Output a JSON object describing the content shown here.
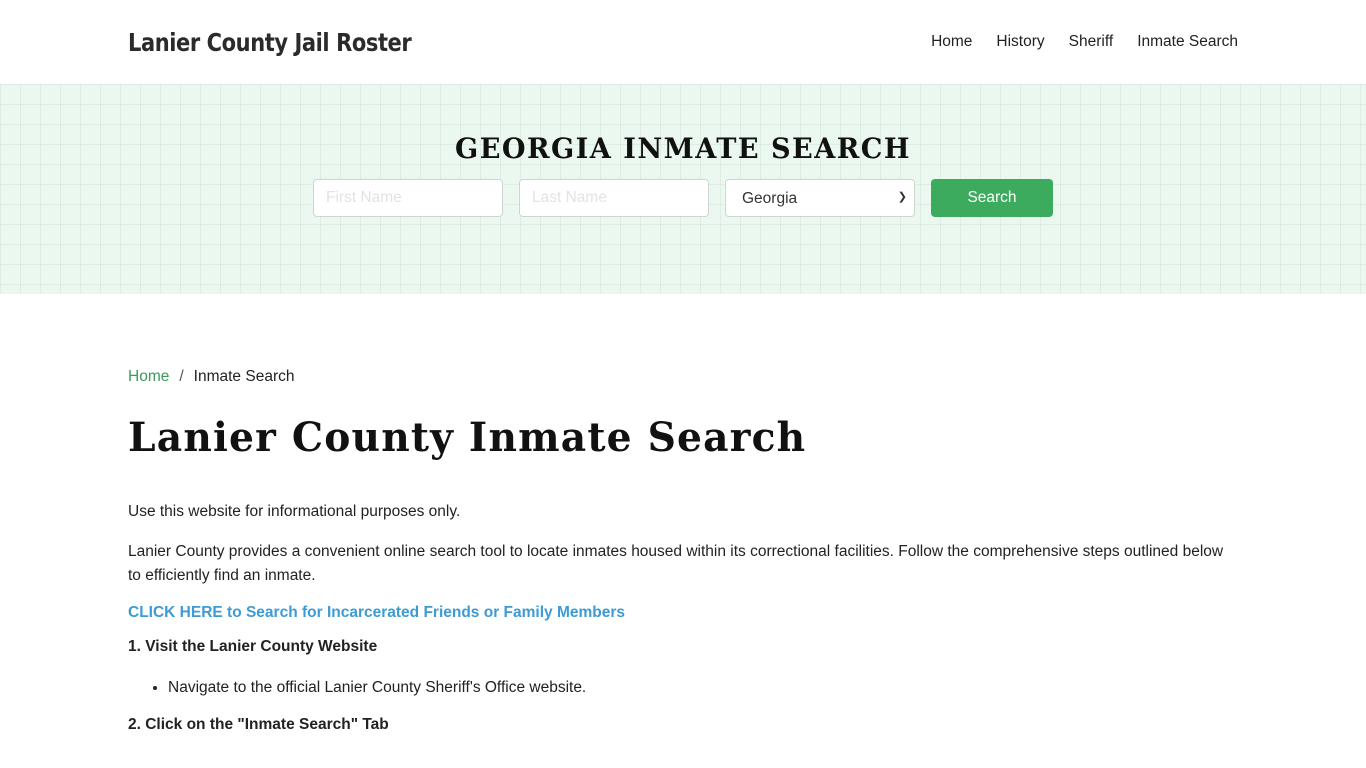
{
  "header": {
    "brand": "Lanier County Jail Roster",
    "nav": [
      {
        "label": "Home"
      },
      {
        "label": "History"
      },
      {
        "label": "Sheriff"
      },
      {
        "label": "Inmate Search"
      }
    ]
  },
  "banner": {
    "title": "GEORGIA INMATE SEARCH",
    "first_name_placeholder": "First Name",
    "last_name_placeholder": "Last Name",
    "state_selected": "Georgia",
    "search_label": "Search",
    "accent_color": "#3cab5e"
  },
  "breadcrumb": {
    "home": "Home",
    "separator": "/",
    "current": "Inmate Search"
  },
  "main": {
    "title": "Lanier County Inmate Search",
    "intro": "Use this website for informational purposes only.",
    "description": "Lanier County provides a convenient online search tool to locate inmates housed within its correctional facilities. Follow the comprehensive steps outlined below to efficiently find an inmate.",
    "cta_link": "CLICK HERE to Search for Incarcerated Friends or Family Members",
    "steps": [
      {
        "heading": "1. Visit the Lanier County Website",
        "bullets": [
          "Navigate to the official Lanier County Sheriff's Office website."
        ]
      },
      {
        "heading": "2. Click on the \"Inmate Search\" Tab",
        "bullets": []
      }
    ]
  }
}
